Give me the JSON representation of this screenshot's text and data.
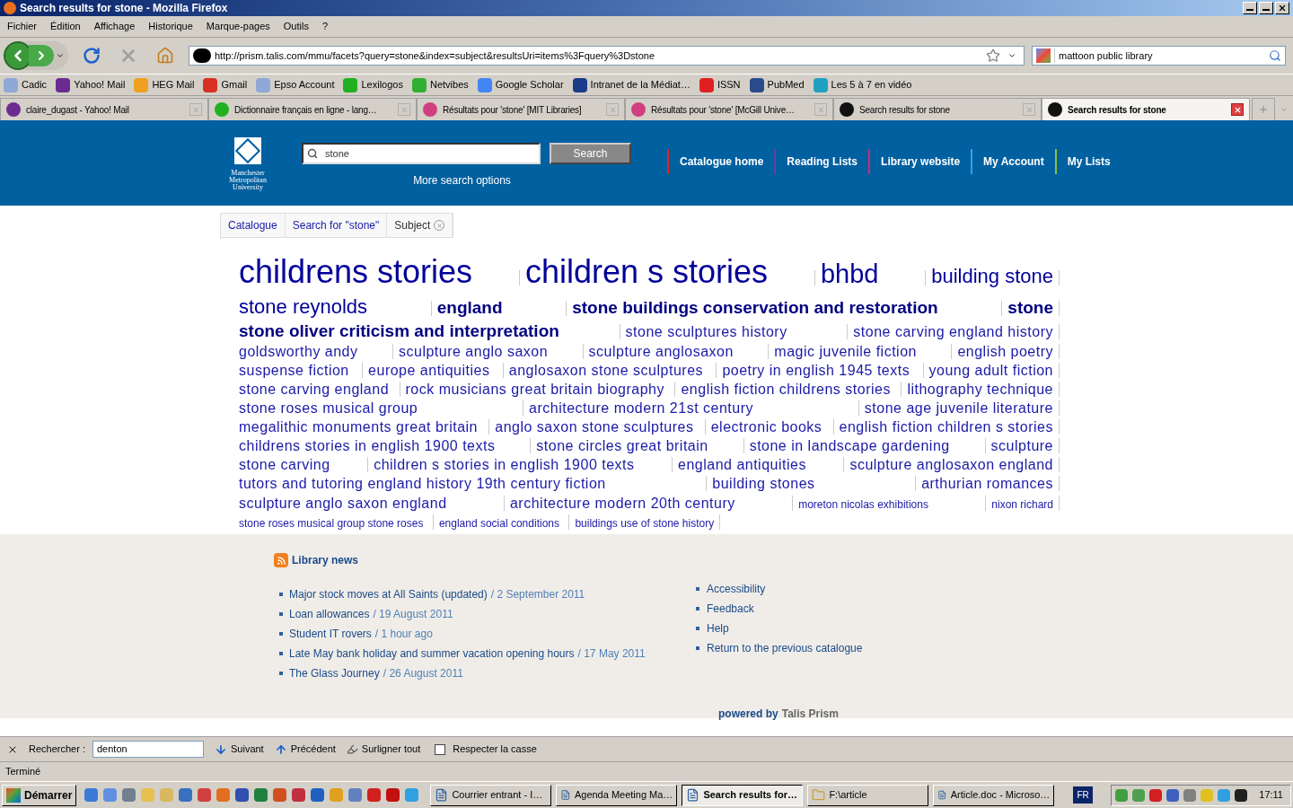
{
  "window": {
    "title": "Search results for stone - Mozilla Firefox"
  },
  "menu": [
    "Fichier",
    "Édition",
    "Affichage",
    "Historique",
    "Marque-pages",
    "Outils",
    "?"
  ],
  "address": {
    "url": "http://prism.talis.com/mmu/facets?query=stone&index=subject&resultsUri=items%3Fquery%3Dstone"
  },
  "web_search": {
    "value": "mattoon public library"
  },
  "bookmarks": [
    {
      "label": "Cadic",
      "color": "#8fa8d8"
    },
    {
      "label": "Yahoo! Mail",
      "color": "#6a2c91"
    },
    {
      "label": "HEG Mail",
      "color": "#f0a020"
    },
    {
      "label": "Gmail",
      "color": "#d93025"
    },
    {
      "label": "Epso Account",
      "color": "#8fa8d8"
    },
    {
      "label": "Lexilogos",
      "color": "#20b020"
    },
    {
      "label": "Netvibes",
      "color": "#30b030"
    },
    {
      "label": "Google Scholar",
      "color": "#4285f4"
    },
    {
      "label": "Intranet de la Médiat…",
      "color": "#1a3a8a"
    },
    {
      "label": "ISSN",
      "color": "#e02020"
    },
    {
      "label": "PubMed",
      "color": "#2a4a8a"
    },
    {
      "label": "Les 5 à 7 en vidéo",
      "color": "#20a0c0"
    }
  ],
  "tabs": [
    {
      "label": "claire_dugast - Yahoo! Mail",
      "selected": false,
      "color": "#6a2c91"
    },
    {
      "label": "Dictionnaire français en ligne - lang…",
      "selected": false,
      "color": "#20b020"
    },
    {
      "label": "Résultats pour 'stone' [MIT Libraries]",
      "selected": false,
      "color": "#d04080"
    },
    {
      "label": "Résultats pour 'stone' [McGill Unive…",
      "selected": false,
      "color": "#d04080"
    },
    {
      "label": "Search results for stone",
      "selected": false,
      "color": "#111111"
    },
    {
      "label": "Search results for stone",
      "selected": true,
      "color": "#111111"
    }
  ],
  "header": {
    "logo_lines": [
      "Manchester",
      "Metropolitan",
      "University"
    ],
    "search_value": "stone",
    "search_button": "Search",
    "more_options": "More search options",
    "nav": [
      {
        "label": "Catalogue home",
        "color": "#e02424"
      },
      {
        "label": "Reading Lists",
        "color": "#6b3fa0"
      },
      {
        "label": "Library website",
        "color": "#e0206a"
      },
      {
        "label": "My Account",
        "color": "#3aa0e0"
      },
      {
        "label": "My Lists",
        "color": "#8cc040"
      }
    ]
  },
  "breadcrumb": [
    {
      "label": "Catalogue",
      "removable": false
    },
    {
      "label": "Search for \"stone\"",
      "removable": false
    },
    {
      "label": "Subject",
      "removable": true
    }
  ],
  "tag_cloud": [
    {
      "label": "childrens stories",
      "kind": "huge"
    },
    {
      "label": "children s stories",
      "kind": "huge"
    },
    {
      "label": "bhbd",
      "kind": "xlarge"
    },
    {
      "label": "building stone",
      "kind": "large"
    },
    {
      "label": "stone reynolds",
      "kind": "large"
    },
    {
      "label": "england",
      "kind": "bold"
    },
    {
      "label": "stone buildings conservation and restoration",
      "kind": "bold"
    },
    {
      "label": "stone",
      "kind": "bold"
    },
    {
      "label": "stone oliver criticism and interpretation",
      "kind": "bold"
    },
    {
      "label": "stone sculptures history",
      "kind": "medium"
    },
    {
      "label": "stone carving england history",
      "kind": "medium"
    },
    {
      "label": "goldsworthy andy",
      "kind": "medium"
    },
    {
      "label": "sculpture anglo saxon",
      "kind": "medium"
    },
    {
      "label": "sculpture anglosaxon",
      "kind": "medium"
    },
    {
      "label": "magic juvenile fiction",
      "kind": "medium"
    },
    {
      "label": "english poetry",
      "kind": "medium"
    },
    {
      "label": "suspense fiction",
      "kind": "medium"
    },
    {
      "label": "europe antiquities",
      "kind": "medium"
    },
    {
      "label": "anglosaxon stone sculptures",
      "kind": "medium"
    },
    {
      "label": "poetry in english 1945 texts",
      "kind": "medium"
    },
    {
      "label": "young adult fiction",
      "kind": "medium"
    },
    {
      "label": "stone carving england",
      "kind": "medium"
    },
    {
      "label": "rock musicians great britain biography",
      "kind": "medium"
    },
    {
      "label": "english fiction childrens stories",
      "kind": "medium"
    },
    {
      "label": "lithography technique",
      "kind": "medium"
    },
    {
      "label": "stone roses musical group",
      "kind": "medium"
    },
    {
      "label": "architecture modern 21st century",
      "kind": "medium"
    },
    {
      "label": "stone age juvenile literature",
      "kind": "medium"
    },
    {
      "label": "megalithic monuments great britain",
      "kind": "medium"
    },
    {
      "label": "anglo saxon stone sculptures",
      "kind": "medium"
    },
    {
      "label": "electronic books",
      "kind": "medium"
    },
    {
      "label": "english fiction children s stories",
      "kind": "medium"
    },
    {
      "label": "childrens stories in english 1900 texts",
      "kind": "medium"
    },
    {
      "label": "stone circles great britain",
      "kind": "medium"
    },
    {
      "label": "stone in landscape gardening",
      "kind": "medium"
    },
    {
      "label": "sculpture",
      "kind": "medium"
    },
    {
      "label": "stone carving",
      "kind": "medium"
    },
    {
      "label": "children s stories in english 1900 texts",
      "kind": "medium"
    },
    {
      "label": "england antiquities",
      "kind": "medium"
    },
    {
      "label": "sculpture anglosaxon england",
      "kind": "medium"
    },
    {
      "label": "tutors and tutoring england history 19th century fiction",
      "kind": "medium"
    },
    {
      "label": "building stones",
      "kind": "medium"
    },
    {
      "label": "arthurian romances",
      "kind": "medium"
    },
    {
      "label": "sculpture anglo saxon england",
      "kind": "medium"
    },
    {
      "label": "architecture modern 20th century",
      "kind": "medium"
    },
    {
      "label": "moreton nicolas exhibitions",
      "kind": "small"
    },
    {
      "label": "nixon richard",
      "kind": "small"
    },
    {
      "label": "stone roses musical group stone roses",
      "kind": "small"
    },
    {
      "label": "england social conditions",
      "kind": "small"
    },
    {
      "label": "buildings use of stone history",
      "kind": "small"
    }
  ],
  "news": {
    "title": "Library news",
    "items": [
      {
        "title": "Major stock moves at All Saints (updated)",
        "date": "/ 2 September 2011"
      },
      {
        "title": "Loan allowances",
        "date": "/ 19 August 2011"
      },
      {
        "title": "Student IT rovers",
        "date": "/ 1 hour ago"
      },
      {
        "title": "Late May bank holiday and summer vacation opening hours",
        "date": "/ 17 May 2011"
      },
      {
        "title": "The Glass Journey",
        "date": "/ 26 August 2011"
      }
    ]
  },
  "footer_links": [
    "Accessibility",
    "Feedback",
    "Help",
    "Return to the previous catalogue"
  ],
  "powered_by": {
    "prefix": "powered by",
    "name": "Talis Prism"
  },
  "find_bar": {
    "label": "Rechercher :",
    "value": "denton",
    "next": "Suivant",
    "previous": "Précédent",
    "highlight": "Surligner tout",
    "match_case": {
      "label": "Respecter la casse",
      "checked": false
    }
  },
  "status": "Terminé",
  "taskbar": {
    "start": "Démarrer",
    "tasks": [
      {
        "label": "Courrier entrant - I…",
        "selected": false
      },
      {
        "label": "Agenda Meeting Ma…",
        "selected": false
      },
      {
        "label": "Search results for…",
        "selected": true
      },
      {
        "label": "F:\\article",
        "selected": false
      },
      {
        "label": "Article.doc - Microso…",
        "selected": false
      }
    ],
    "language": "FR",
    "clock": "17:11"
  }
}
